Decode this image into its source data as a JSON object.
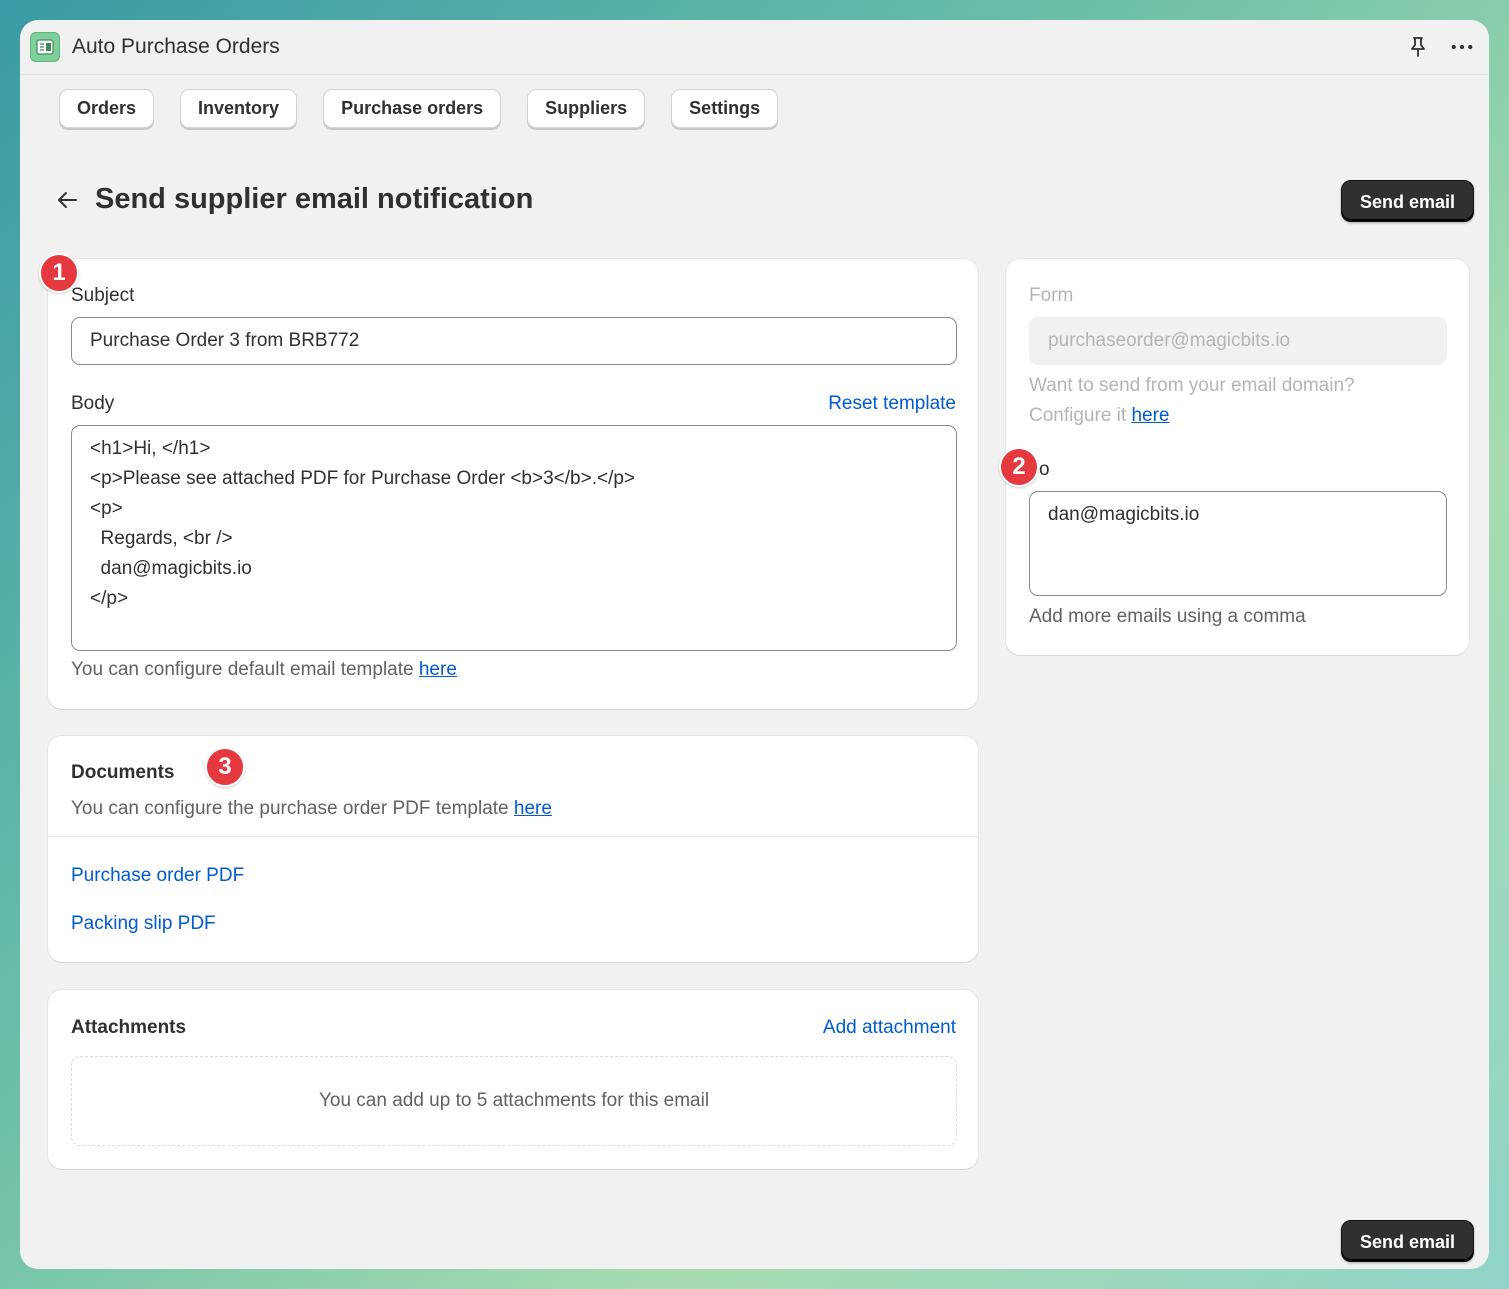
{
  "app": {
    "title": "Auto Purchase Orders",
    "icon": "app-icon",
    "pin_icon": "pin-icon",
    "more_icon": "more-icon"
  },
  "nav": {
    "items": [
      {
        "label": "Orders"
      },
      {
        "label": "Inventory"
      },
      {
        "label": "Purchase orders"
      },
      {
        "label": "Suppliers"
      },
      {
        "label": "Settings"
      }
    ]
  },
  "header": {
    "title": "Send supplier email notification",
    "send_label": "Send email",
    "back_icon": "arrow-left-icon"
  },
  "email": {
    "subject_label": "Subject",
    "subject_value": "Purchase Order 3 from BRB772",
    "body_label": "Body",
    "reset_label": "Reset template",
    "body_lines": [
      "<h1>Hi, </h1>",
      "<p>Please see attached PDF for Purchase Order <b>3</b>.</p>",
      "<p>",
      "  Regards, <br />",
      "  dan@magicbits.io",
      "</p>"
    ],
    "template_help": "You can configure default email template ",
    "template_link": "here"
  },
  "sender": {
    "form_label": "Form",
    "form_value": "purchaseorder@magicbits.io",
    "domain_help_1": "Want to send from your email domain?",
    "domain_help_2": "Configure it ",
    "domain_link": "here",
    "to_label": "o",
    "to_value": "dan@magicbits.io",
    "to_help": "Add more emails using a comma"
  },
  "documents": {
    "title": "Documents",
    "help": "You can configure the purchase order PDF template ",
    "help_link": "here",
    "items": [
      {
        "label": "Purchase order PDF"
      },
      {
        "label": "Packing slip PDF"
      }
    ]
  },
  "attachments": {
    "title": "Attachments",
    "add_label": "Add attachment",
    "empty_text": "You can add up to 5 attachments for this email"
  },
  "footer": {
    "send_label": "Send email"
  },
  "badges": [
    "1",
    "2",
    "3"
  ],
  "colors": {
    "accent_link": "#005bd3",
    "primary_button": "#303030",
    "badge": "#e5393f"
  }
}
